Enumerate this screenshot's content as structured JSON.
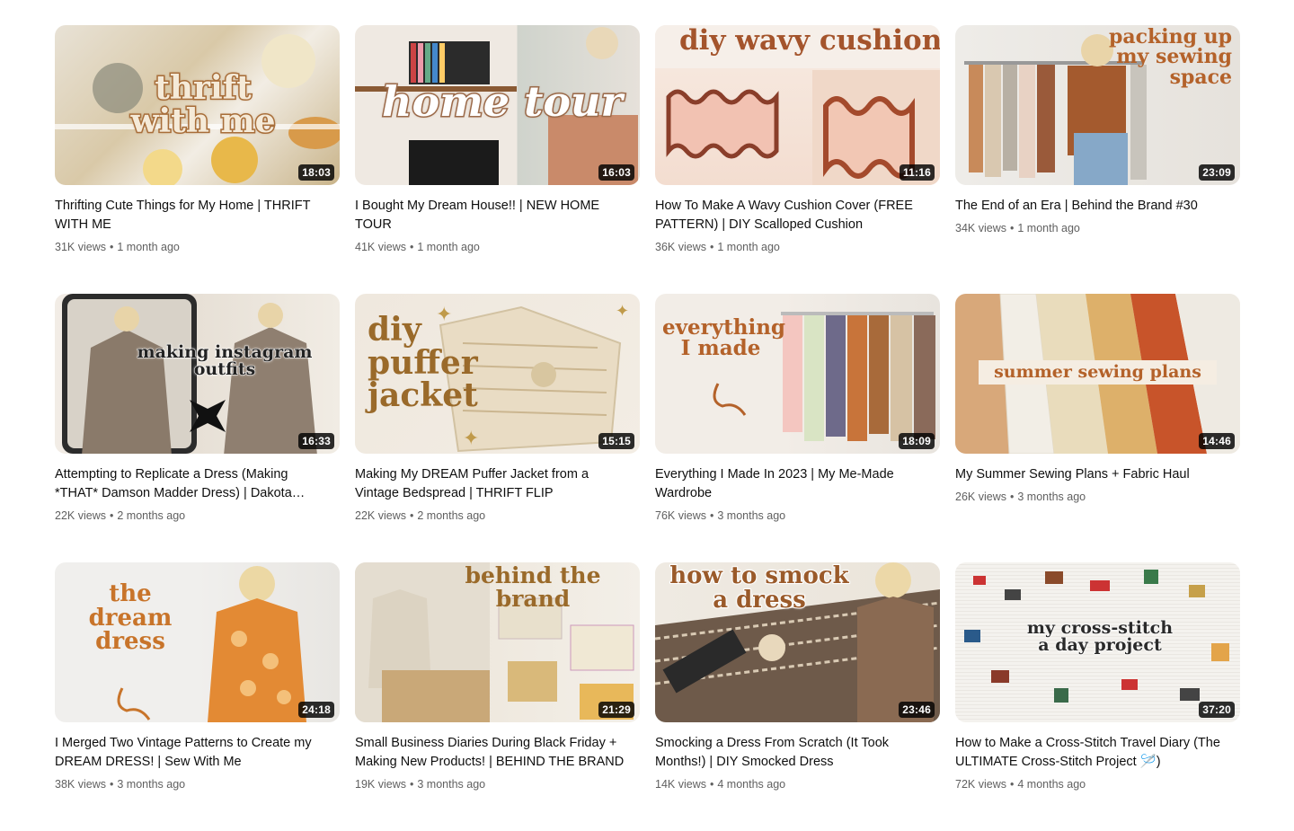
{
  "videos": [
    {
      "title": "Thrifting Cute Things for My Home | THRIFT WITH ME",
      "views": "31K views",
      "age": "1 month ago",
      "duration": "18:03",
      "thumb_text": "thrift\nwith me",
      "theme": "thrift"
    },
    {
      "title": "I Bought My Dream House!! | NEW HOME TOUR",
      "views": "41K views",
      "age": "1 month ago",
      "duration": "16:03",
      "thumb_text": "home tour",
      "theme": "home"
    },
    {
      "title": "How To Make A Wavy Cushion Cover (FREE PATTERN) | DIY Scalloped Cushion",
      "views": "36K views",
      "age": "1 month ago",
      "duration": "11:16",
      "thumb_text": "diy wavy cushion",
      "theme": "cushion"
    },
    {
      "title": "The End of an Era | Behind the Brand #30",
      "views": "34K views",
      "age": "1 month ago",
      "duration": "23:09",
      "thumb_text": "packing up\nmy sewing\nspace",
      "theme": "packing"
    },
    {
      "title": "Attempting to Replicate a Dress (Making *THAT* Damson Madder Dress) | Dakota Farrell",
      "views": "22K views",
      "age": "2 months ago",
      "duration": "16:33",
      "thumb_text": "making instagram\noutfits",
      "theme": "instagram"
    },
    {
      "title": "Making My DREAM Puffer Jacket from a Vintage Bedspread | THRIFT FLIP",
      "views": "22K views",
      "age": "2 months ago",
      "duration": "15:15",
      "thumb_text": "diy\npuffer\njacket",
      "theme": "puffer"
    },
    {
      "title": "Everything I Made In 2023 | My Me-Made Wardrobe",
      "views": "76K views",
      "age": "3 months ago",
      "duration": "18:09",
      "thumb_text": "everything\nI made",
      "theme": "everything"
    },
    {
      "title": "My Summer Sewing Plans + Fabric Haul",
      "views": "26K views",
      "age": "3 months ago",
      "duration": "14:46",
      "thumb_text": "summer sewing plans",
      "theme": "summer"
    },
    {
      "title": "I Merged Two Vintage Patterns to Create my DREAM DRESS! | Sew With Me",
      "views": "38K views",
      "age": "3 months ago",
      "duration": "24:18",
      "thumb_text": "the\ndream\ndress",
      "theme": "dream"
    },
    {
      "title": "Small Business Diaries During Black Friday + Making New Products! | BEHIND THE BRAND",
      "views": "19K views",
      "age": "3 months ago",
      "duration": "21:29",
      "thumb_text": "behind the brand",
      "theme": "brand"
    },
    {
      "title": "Smocking a Dress From Scratch (It Took Months!) | DIY Smocked Dress",
      "views": "14K views",
      "age": "4 months ago",
      "duration": "23:46",
      "thumb_text": "how to smock\na dress",
      "theme": "smock"
    },
    {
      "title": "How to Make a Cross-Stitch Travel Diary (The ULTIMATE Cross-Stitch Project 🪡)",
      "views": "72K views",
      "age": "4 months ago",
      "duration": "37:20",
      "thumb_text": "my cross-stitch\na day project",
      "theme": "cross"
    }
  ],
  "colors": {
    "accent": "#b4622a",
    "text": "#0f0f0f",
    "subtext": "#606060"
  }
}
